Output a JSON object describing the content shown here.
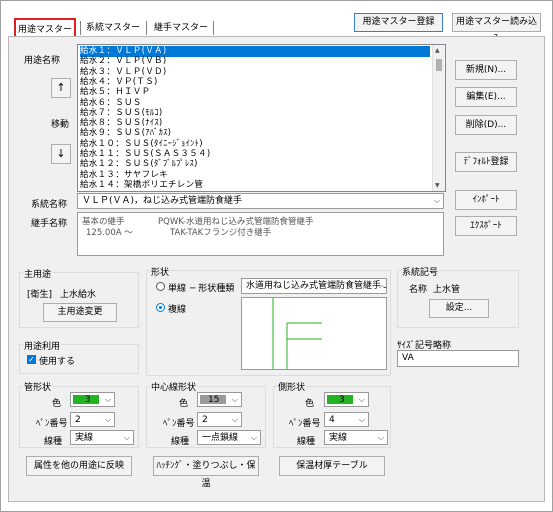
{
  "tabs": [
    "用途マスター",
    "系統マスター",
    "継手マスター"
  ],
  "top_buttons": {
    "register": "用途マスター登録",
    "load": "用途マスター読み込み"
  },
  "usage": {
    "label": "用途名称",
    "items": [
      "給水１：ＶＬＰ(ＶＡ)",
      "給水２：ＶＬＰ(ＶＢ)",
      "給水３：ＶＬＰ(ＶＤ)",
      "給水４：ＶＰ(ＴＳ)",
      "給水５：ＨＩＶＰ",
      "給水６：ＳＵＳ",
      "給水７：ＳＵＳ(ﾓﾙｺ)",
      "給水８：ＳＵＳ(ﾅｲｽ)",
      "給水９：ＳＵＳ(ｱﾊﾞｶｽ)",
      "給水１０：ＳＵＳ(ﾀｲﾆｰｼﾞｮｲﾝﾄ)",
      "給水１１：ＳＵＳ(ＳＡＳ３５４)",
      "給水１２：ＳＵＳ(ﾀﾞﾌﾞﾙﾌﾟﾚｽ)",
      "給水１３：サヤフレキ",
      "給水１４：架橋ポリエチレン管"
    ]
  },
  "move": {
    "label": "移動",
    "up": "↑",
    "down": "↓"
  },
  "side_buttons": {
    "new": "新規(N)...",
    "edit": "編集(E)...",
    "delete": "削除(D)...",
    "default_register": "ﾃﾞﾌｫﾙﾄ登録",
    "import": "ｲﾝﾎﾟｰﾄ",
    "export": "ｴｸｽﾎﾟｰﾄ"
  },
  "system": {
    "label": "系統名称",
    "value": "ＶＬＰ(ＶＡ)，ねじ込み式管端防食継手"
  },
  "fitting": {
    "label": "継手名称",
    "col1": [
      "基本の継手",
      "125.00A ～"
    ],
    "col2": [
      "PQWK-水道用ねじ込み式管端防食管継手",
      "TAK-TAKフランジ付き継手"
    ]
  },
  "main_use": {
    "title": "主用途",
    "prefix": "[衛生]",
    "value": "上水給水",
    "change_button": "主用途変更"
  },
  "shape": {
    "title": "形状",
    "single": "単線",
    "double": "複線",
    "type_label": "─ 形状種類",
    "type_value": "水道用ねじ込み式管端防食管継手Ｊ",
    "selected": "複線"
  },
  "system_symbol": {
    "title": "系統記号",
    "name_label": "名称",
    "name_value": "上水管",
    "settings_button": "設定..."
  },
  "usage_use": {
    "title": "用途利用",
    "checkbox": "使用する",
    "checked": true
  },
  "size_abbr": {
    "title": "ｻｲｽﾞ記号略称",
    "value": "VA"
  },
  "pipe_shape": {
    "title": "管形状",
    "color_label": "色",
    "color_value": "3",
    "color_hex": "#24b324",
    "pen_label": "ﾍﾟﾝ番号",
    "pen_value": "2",
    "line_label": "線種",
    "line_value": "実線"
  },
  "center_shape": {
    "title": "中心線形状",
    "color_label": "色",
    "color_value": "15",
    "color_hex": "#9a9a9a",
    "pen_label": "ﾍﾟﾝ番号",
    "pen_value": "2",
    "line_label": "線種",
    "line_value": "一点鎖線"
  },
  "side_shape": {
    "title": "側形状",
    "color_label": "色",
    "color_value": "3",
    "color_hex": "#24b324",
    "pen_label": "ﾍﾟﾝ番号",
    "pen_value": "4",
    "line_label": "線種",
    "line_value": "実線"
  },
  "bottom_buttons": {
    "reflect": "属性を他の用途に反映",
    "hatch": "ﾊｯﾁﾝｸﾞ・塗りつぶし・保温",
    "insulation": "保温材厚テーブル"
  }
}
